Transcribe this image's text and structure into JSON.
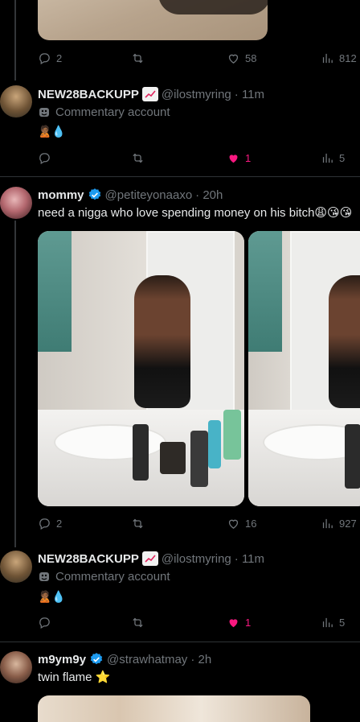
{
  "top_tweet_actions": {
    "replies": "2",
    "likes": "58",
    "views": "812"
  },
  "reply1": {
    "name": "NEW28BACKUPP",
    "handle": "@ilostmyring",
    "time": "· 11m",
    "bio": "Commentary account",
    "emojis": "🙎🏾💧",
    "likes": "1",
    "views": "5"
  },
  "tweet2": {
    "name": "mommy",
    "handle": "@petiteyonaaxo",
    "time": "· 20h",
    "text": "need a nigga who love spending money on his bitch😩😘😘",
    "replies": "2",
    "likes": "16",
    "views": "927"
  },
  "reply2": {
    "name": "NEW28BACKUPP",
    "handle": "@ilostmyring",
    "time": "· 11m",
    "bio": "Commentary account",
    "emojis": "🙎🏾💧",
    "likes": "1",
    "views": "5"
  },
  "tweet3": {
    "name": "m9ym9y",
    "handle": "@strawhatmay",
    "time": "· 2h",
    "text": "twin flame ⭐"
  },
  "colors": {
    "background": "#000000",
    "text": "#e7e9ea",
    "muted": "#71767b",
    "like_pink": "#f91880",
    "verified_blue": "#1d9bf0"
  }
}
